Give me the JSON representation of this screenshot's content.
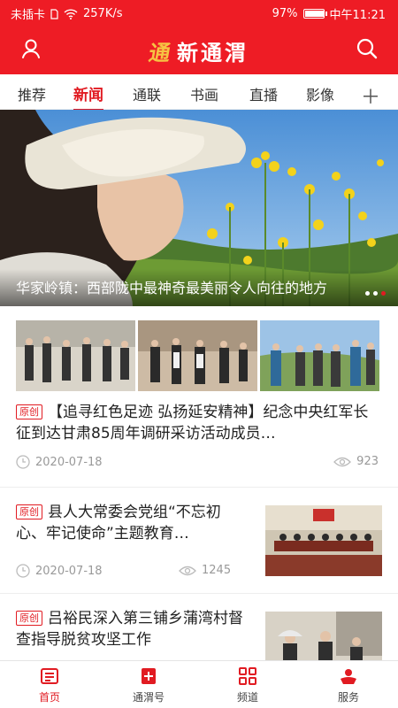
{
  "status_bar": {
    "carrier": "未插卡",
    "speed": "257K/s",
    "battery": "97%",
    "battery_level": 0.97,
    "time": "中午11:21"
  },
  "header": {
    "logo_text": "新通渭",
    "logo_mark": "通",
    "icons": {
      "left": "user-icon",
      "right": "search-icon"
    },
    "brand_color": "#ee1c25"
  },
  "tabs": [
    {
      "label": "推荐",
      "active": false
    },
    {
      "label": "新闻",
      "active": true
    },
    {
      "label": "通联",
      "active": false
    },
    {
      "label": "书画",
      "active": false
    },
    {
      "label": "直播",
      "active": false
    },
    {
      "label": "影像",
      "active": false
    }
  ],
  "hero": {
    "title": "华家岭镇：西部陇中最神奇最美丽令人向往的地方"
  },
  "articles": [
    {
      "tag": "原创",
      "title": "【追寻红色足迹 弘扬延安精神】纪念中央红军长征到达甘肃85周年调研采访活动成员…",
      "date": "2020-07-18",
      "views": "923",
      "layout": "three-images"
    },
    {
      "tag": "原创",
      "title": "县人大常委会党组“不忘初心、牢记使命”主题教育…",
      "date": "2020-07-18",
      "views": "1245",
      "layout": "right-thumb"
    },
    {
      "tag": "原创",
      "title": "吕裕民深入第三铺乡蒲湾村督查指导脱贫攻坚工作",
      "layout": "right-thumb"
    }
  ],
  "bottom_nav": [
    {
      "label": "首页",
      "icon": "news-icon",
      "active": true
    },
    {
      "label": "通渭号",
      "icon": "plus-square-icon",
      "active": false
    },
    {
      "label": "频道",
      "icon": "grid-icon",
      "active": false
    },
    {
      "label": "服务",
      "icon": "service-icon",
      "active": false
    }
  ]
}
